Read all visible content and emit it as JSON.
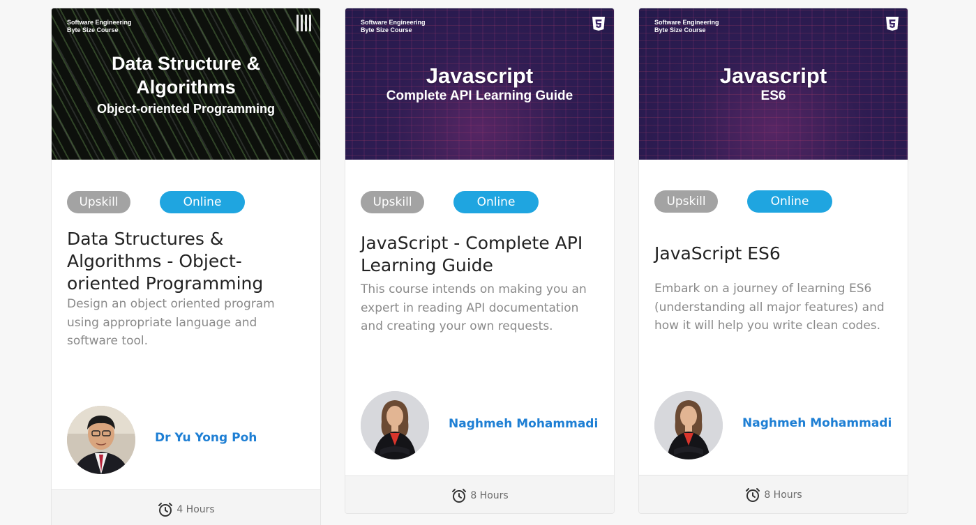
{
  "cards": [
    {
      "banner": {
        "kicker": "Software Engineering\nByte Size Course",
        "title": "Data Structure &\nAlgorithms",
        "subtitle": "Object-oriented Programming"
      },
      "tags": {
        "type": "Upskill",
        "mode": "Online"
      },
      "title": "Data Structures & Algorithms - Object-oriented Programming",
      "description": "Design an object oriented program using appropriate language and software tool.",
      "instructor": "Dr Yu Yong Poh",
      "duration": "4 Hours"
    },
    {
      "banner": {
        "kicker": "Software Engineering\nByte Size Course",
        "title": "Javascript",
        "subtitle": "Complete API Learning Guide"
      },
      "tags": {
        "type": "Upskill",
        "mode": "Online"
      },
      "title": "JavaScript - Complete API Learning Guide",
      "description": "This course intends on making you an expert in reading API documentation and creating your own requests.",
      "instructor": "Naghmeh Mohammadi",
      "duration": "8 Hours"
    },
    {
      "banner": {
        "kicker": "Software Engineering\nByte Size Course",
        "title": "Javascript",
        "subtitle": "ES6"
      },
      "tags": {
        "type": "Upskill",
        "mode": "Online"
      },
      "title": "JavaScript ES6",
      "description": "Embark on a journey of learning ES6 (understanding all major features) and how it will help you write clean codes.",
      "instructor": "Naghmeh Mohammadi",
      "duration": "8 Hours"
    }
  ],
  "colors": {
    "upskill_badge": "#a3a3a3",
    "online_badge": "#1fa5e0",
    "instructor_link": "#1e7fd4"
  },
  "icons": {
    "banner_logo_card1": "qr-code-icon",
    "banner_logo_js": "html5-icon",
    "duration": "alarm-clock-icon"
  }
}
